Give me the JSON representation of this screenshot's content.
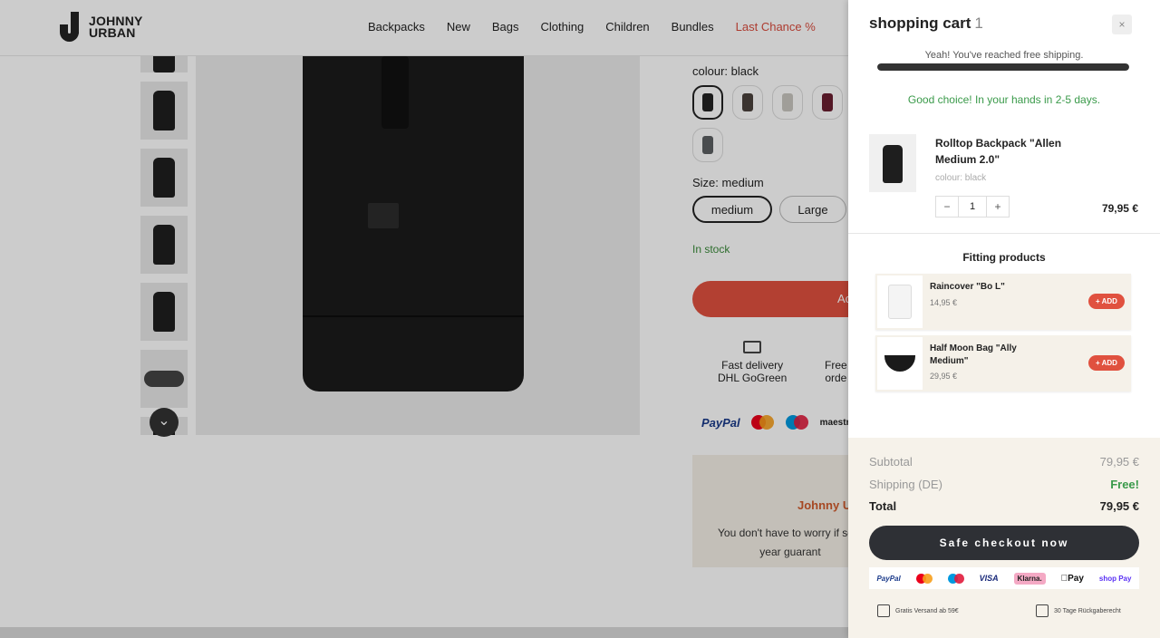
{
  "header": {
    "logo_line1": "JOHNNY",
    "logo_line2": "URBAN",
    "nav": [
      "Backpacks",
      "New",
      "Bags",
      "Clothing",
      "Children",
      "Bundles"
    ],
    "nav_last": "Last Chance %"
  },
  "product": {
    "colour_label": "colour:",
    "colour_value": "black",
    "size_label": "Size: medium",
    "sizes": [
      "medium",
      "Large"
    ],
    "stock": "In stock",
    "add_to_cart": "Ac",
    "perk1": "Fast delivery",
    "perk1b": "DHL GoGreen",
    "perk2": "Free",
    "perk2b": "orde",
    "pay_paypal": "PayPal",
    "pay_maestro": "maestro",
    "guarantee_title": "Johnny Ur",
    "guarantee_text1": "You don't have to worry if som",
    "guarantee_text2": "year guarant",
    "swatch_colors": [
      "#222222",
      "#4a423c",
      "#c9c6c0",
      "#6a1f30",
      "#5c5f62"
    ]
  },
  "cart": {
    "title": "shopping cart",
    "count": "1",
    "close": "×",
    "ship_msg": "Yeah! You've reached free shipping.",
    "ship_progress": 1.0,
    "good_msg": "Good choice! In your hands in 2-5 days.",
    "item": {
      "name": "Rolltop Backpack \"Allen Medium 2.0\"",
      "attr": "colour: black",
      "qty": "1",
      "minus": "−",
      "plus": "+",
      "price": "79,95 €"
    },
    "fitting_title": "Fitting products",
    "fitting": [
      {
        "name": "Raincover \"Bo L\"",
        "price": "14,95 €",
        "add": "+ ADD"
      },
      {
        "name": "Half Moon Bag \"Ally Medium\"",
        "price": "29,95 €",
        "add": "+ ADD"
      }
    ],
    "subtotal_label": "Subtotal",
    "subtotal": "79,95 €",
    "shipping_label": "Shipping (DE)",
    "shipping": "Free!",
    "total_label": "Total",
    "total": "79,95 €",
    "checkout": "Safe checkout now",
    "pay_icons": {
      "paypal": "PayPal",
      "visa": "VISA",
      "klarna": "Klarna.",
      "applepay": "Pay",
      "shoppay": "shop Pay"
    },
    "foot1": "Gratis Versand ab 59€",
    "foot2": "30 Tage Rückgaberecht"
  },
  "colors": {
    "accent": "#e0513f",
    "success": "#3a9a4a",
    "dark": "#2e3035"
  }
}
